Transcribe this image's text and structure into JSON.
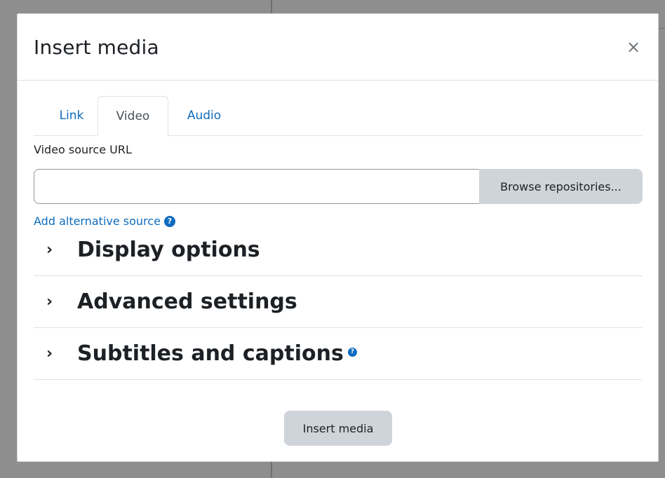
{
  "modal": {
    "title": "Insert media",
    "close_symbol": "×"
  },
  "tabs": [
    {
      "label": "Link",
      "active": false
    },
    {
      "label": "Video",
      "active": true
    },
    {
      "label": "Audio",
      "active": false
    }
  ],
  "video_source": {
    "label": "Video source URL",
    "value": "",
    "placeholder": "",
    "browse_label": "Browse repositories..."
  },
  "alt_source": {
    "label": "Add alternative source",
    "help_icon": "question-circle-icon"
  },
  "sections": [
    {
      "title": "Display options",
      "has_help": false
    },
    {
      "title": "Advanced settings",
      "has_help": false
    },
    {
      "title": "Subtitles and captions",
      "has_help": true
    }
  ],
  "footer": {
    "insert_label": "Insert media"
  },
  "colors": {
    "link": "#0f6cbf",
    "text": "#1d2125",
    "button_bg": "#ced4da",
    "backdrop": "#8e8e8e"
  }
}
